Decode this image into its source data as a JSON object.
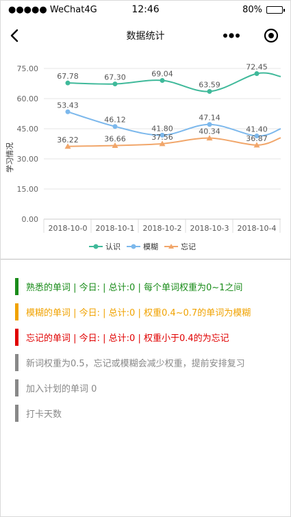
{
  "status_bar": {
    "carrier": "●●●●● WeChat4G",
    "time": "12:46",
    "battery_text": "80%",
    "battery_level": 0.8
  },
  "nav": {
    "title": "数据统计",
    "back_icon": "chevron-left-icon",
    "more_icon": "more-dots-icon",
    "close_icon": "target-circle-icon"
  },
  "chart_data": {
    "type": "line",
    "ylabel": "学习情况",
    "ylim": [
      0,
      75
    ],
    "yticks": [
      "0.00",
      "15.00",
      "30.00",
      "45.00",
      "60.00",
      "75.00"
    ],
    "ytick_values": [
      0,
      15,
      30,
      45,
      60,
      75
    ],
    "categories": [
      "2018-10-0",
      "2018-10-1",
      "2018-10-2",
      "2018-10-3",
      "2018-10-4"
    ],
    "series": [
      {
        "name": "认识",
        "color": "#3fb99a",
        "marker": "circle",
        "values": [
          67.78,
          67.3,
          69.04,
          63.59,
          72.45
        ],
        "labels": [
          "67.78",
          "67.30",
          "69.04",
          "63.59",
          "72.45"
        ],
        "trailing_value": 71.0
      },
      {
        "name": "模糊",
        "color": "#7cb8ec",
        "marker": "circle",
        "values": [
          53.43,
          46.12,
          41.8,
          47.14,
          41.4
        ],
        "labels": [
          "53.43",
          "46.12",
          "41.80",
          "47.14",
          "41.40"
        ],
        "trailing_value": 45.0
      },
      {
        "name": "忘记",
        "color": "#f1a66a",
        "marker": "triangle",
        "values": [
          36.22,
          36.66,
          37.56,
          40.34,
          36.87
        ],
        "labels": [
          "36.22",
          "36.66",
          "37.56",
          "40.34",
          "36.87"
        ],
        "trailing_value": 40.5
      }
    ],
    "grid": true,
    "legend_position": "bottom-center"
  },
  "info": {
    "familiar": {
      "text": "熟悉的单词 | 今日: | 总计:0 | 每个单词权重为0~1之间",
      "color": "#1a8c1a"
    },
    "fuzzy": {
      "text": "模糊的单词 | 今日: | 总计:0 | 权重0.4~0.7的单词为模糊",
      "color": "#f0a200"
    },
    "forgot": {
      "text": "忘记的单词 | 今日: | 总计:0 | 权重小于0.4的为忘记",
      "color": "#e00000"
    },
    "note": {
      "text": "新词权重为0.5，忘记或模糊会减少权重，提前安排复习",
      "color": "#888888"
    },
    "plan": {
      "text": "加入计划的单词 0",
      "color": "#888888"
    },
    "checkin": {
      "text": "打卡天数",
      "color": "#888888"
    }
  }
}
